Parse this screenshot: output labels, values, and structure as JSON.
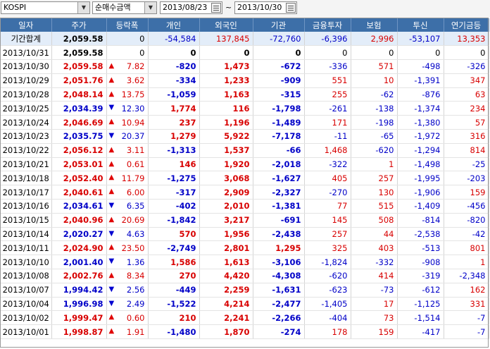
{
  "toolbar": {
    "market": "KOSPI",
    "mode": "순매수금액",
    "date_from": "2013/08/23",
    "date_separator": "~",
    "date_to": "2013/10/30"
  },
  "columns": [
    "일자",
    "주가",
    "등락폭",
    "개인",
    "외국인",
    "기관",
    "금융투자",
    "보험",
    "투신",
    "연기금등"
  ],
  "summary": {
    "date": "기간합계",
    "price": "2,059.58",
    "change": "0",
    "indiv": "-54,584",
    "foreign": "137,845",
    "inst": "-72,760",
    "fin": "-6,396",
    "ins": "2,996",
    "trust": "-53,107",
    "pension": "13,353"
  },
  "rows": [
    {
      "date": "2013/10/31",
      "price": "2,059.58",
      "dir": "",
      "change": "0",
      "indiv": "0",
      "foreign": "0",
      "inst": "0",
      "fin": "0",
      "ins": "0",
      "trust": "0",
      "pension": "0"
    },
    {
      "date": "2013/10/30",
      "price": "2,059.58",
      "dir": "up",
      "change": "7.82",
      "indiv": "-820",
      "foreign": "1,473",
      "inst": "-672",
      "fin": "-336",
      "ins": "571",
      "trust": "-498",
      "pension": "-326"
    },
    {
      "date": "2013/10/29",
      "price": "2,051.76",
      "dir": "up",
      "change": "3.62",
      "indiv": "-334",
      "foreign": "1,233",
      "inst": "-909",
      "fin": "551",
      "ins": "10",
      "trust": "-1,391",
      "pension": "347"
    },
    {
      "date": "2013/10/28",
      "price": "2,048.14",
      "dir": "up",
      "change": "13.75",
      "indiv": "-1,059",
      "foreign": "1,163",
      "inst": "-315",
      "fin": "255",
      "ins": "-62",
      "trust": "-876",
      "pension": "63"
    },
    {
      "date": "2013/10/25",
      "price": "2,034.39",
      "dir": "down",
      "change": "12.30",
      "indiv": "1,774",
      "foreign": "116",
      "inst": "-1,798",
      "fin": "-261",
      "ins": "-138",
      "trust": "-1,374",
      "pension": "234"
    },
    {
      "date": "2013/10/24",
      "price": "2,046.69",
      "dir": "up",
      "change": "10.94",
      "indiv": "237",
      "foreign": "1,196",
      "inst": "-1,489",
      "fin": "171",
      "ins": "-198",
      "trust": "-1,380",
      "pension": "57"
    },
    {
      "date": "2013/10/23",
      "price": "2,035.75",
      "dir": "down",
      "change": "20.37",
      "indiv": "1,279",
      "foreign": "5,922",
      "inst": "-7,178",
      "fin": "-11",
      "ins": "-65",
      "trust": "-1,972",
      "pension": "316"
    },
    {
      "date": "2013/10/22",
      "price": "2,056.12",
      "dir": "up",
      "change": "3.11",
      "indiv": "-1,313",
      "foreign": "1,537",
      "inst": "-66",
      "fin": "1,468",
      "ins": "-620",
      "trust": "-1,294",
      "pension": "814"
    },
    {
      "date": "2013/10/21",
      "price": "2,053.01",
      "dir": "up",
      "change": "0.61",
      "indiv": "146",
      "foreign": "1,920",
      "inst": "-2,018",
      "fin": "-322",
      "ins": "1",
      "trust": "-1,498",
      "pension": "-25"
    },
    {
      "date": "2013/10/18",
      "price": "2,052.40",
      "dir": "up",
      "change": "11.79",
      "indiv": "-1,275",
      "foreign": "3,068",
      "inst": "-1,627",
      "fin": "405",
      "ins": "257",
      "trust": "-1,995",
      "pension": "-203"
    },
    {
      "date": "2013/10/17",
      "price": "2,040.61",
      "dir": "up",
      "change": "6.00",
      "indiv": "-317",
      "foreign": "2,909",
      "inst": "-2,327",
      "fin": "-270",
      "ins": "130",
      "trust": "-1,906",
      "pension": "159"
    },
    {
      "date": "2013/10/16",
      "price": "2,034.61",
      "dir": "down",
      "change": "6.35",
      "indiv": "-402",
      "foreign": "2,010",
      "inst": "-1,381",
      "fin": "77",
      "ins": "515",
      "trust": "-1,409",
      "pension": "-456"
    },
    {
      "date": "2013/10/15",
      "price": "2,040.96",
      "dir": "up",
      "change": "20.69",
      "indiv": "-1,842",
      "foreign": "3,217",
      "inst": "-691",
      "fin": "145",
      "ins": "508",
      "trust": "-814",
      "pension": "-820"
    },
    {
      "date": "2013/10/14",
      "price": "2,020.27",
      "dir": "down",
      "change": "4.63",
      "indiv": "570",
      "foreign": "1,956",
      "inst": "-2,438",
      "fin": "257",
      "ins": "44",
      "trust": "-2,538",
      "pension": "-42"
    },
    {
      "date": "2013/10/11",
      "price": "2,024.90",
      "dir": "up",
      "change": "23.50",
      "indiv": "-2,749",
      "foreign": "2,801",
      "inst": "1,295",
      "fin": "325",
      "ins": "403",
      "trust": "-513",
      "pension": "801"
    },
    {
      "date": "2013/10/10",
      "price": "2,001.40",
      "dir": "down",
      "change": "1.36",
      "indiv": "1,586",
      "foreign": "1,613",
      "inst": "-3,106",
      "fin": "-1,824",
      "ins": "-332",
      "trust": "-908",
      "pension": "1"
    },
    {
      "date": "2013/10/08",
      "price": "2,002.76",
      "dir": "up",
      "change": "8.34",
      "indiv": "270",
      "foreign": "4,420",
      "inst": "-4,308",
      "fin": "-620",
      "ins": "414",
      "trust": "-319",
      "pension": "-2,348"
    },
    {
      "date": "2013/10/07",
      "price": "1,994.42",
      "dir": "down",
      "change": "2.56",
      "indiv": "-449",
      "foreign": "2,259",
      "inst": "-1,631",
      "fin": "-623",
      "ins": "-73",
      "trust": "-612",
      "pension": "162"
    },
    {
      "date": "2013/10/04",
      "price": "1,996.98",
      "dir": "down",
      "change": "2.49",
      "indiv": "-1,522",
      "foreign": "4,214",
      "inst": "-2,477",
      "fin": "-1,405",
      "ins": "17",
      "trust": "-1,125",
      "pension": "331"
    },
    {
      "date": "2013/10/02",
      "price": "1,999.47",
      "dir": "up",
      "change": "0.60",
      "indiv": "210",
      "foreign": "2,241",
      "inst": "-2,266",
      "fin": "-404",
      "ins": "73",
      "trust": "-1,514",
      "pension": "-7"
    },
    {
      "date": "2013/10/01",
      "price": "1,998.87",
      "dir": "up",
      "change": "1.91",
      "indiv": "-1,480",
      "foreign": "1,870",
      "inst": "-274",
      "fin": "178",
      "ins": "159",
      "trust": "-417",
      "pension": "-7"
    }
  ],
  "colors": {
    "header_bg": "#3d6fa8",
    "summary_bg": "#e3edf9",
    "positive": "#d80000",
    "negative": "#0000c8"
  },
  "icons": {
    "up": "up-triangle-icon",
    "down": "down-triangle-icon",
    "calendar": "calendar-icon",
    "dropdown": "chevron-down-icon"
  }
}
